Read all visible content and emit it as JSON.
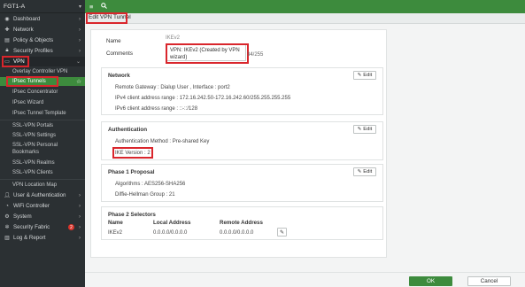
{
  "device": "FGT1-A",
  "topbar": {
    "menu_icon": "≡",
    "search_icon": "🔍"
  },
  "breadcrumb": "Edit VPN Tunnel",
  "sidebar": {
    "items": [
      {
        "label": "Dashboard",
        "icon": "dashboard-icon"
      },
      {
        "label": "Network",
        "icon": "network-icon"
      },
      {
        "label": "Policy & Objects",
        "icon": "policy-icon"
      },
      {
        "label": "Security Profiles",
        "icon": "lock-icon"
      },
      {
        "label": "VPN",
        "icon": "monitor-icon"
      },
      {
        "label": "User & Authentication",
        "icon": "user-icon"
      },
      {
        "label": "WiFi Controller",
        "icon": "wifi-icon"
      },
      {
        "label": "System",
        "icon": "gear-icon"
      },
      {
        "label": "Security Fabric",
        "icon": "fabric-icon",
        "badge": "2"
      },
      {
        "label": "Log & Report",
        "icon": "chart-icon"
      }
    ],
    "vpn_sub": [
      "Overlay Controller VPN",
      "IPsec Tunnels",
      "IPsec Concentrator",
      "IPsec Wizard",
      "IPsec Tunnel Template",
      "SSL-VPN Portals",
      "SSL-VPN Settings",
      "SSL-VPN Personal Bookmarks",
      "SSL-VPN Realms",
      "SSL-VPN Clients",
      "VPN Location Map"
    ]
  },
  "form": {
    "name_label": "Name",
    "name_value": "IKEv2",
    "comments_label": "Comments",
    "comments_value": "VPN: IKEv2 (Created by VPN wizard)",
    "comments_counter": "34/255"
  },
  "sections": {
    "network": {
      "title": "Network",
      "lines": [
        "Remote Gateway : Dialup User , Interface : port2",
        "IPv4 client address range : 172.16.242.50-172.16.242.60/255.255.255.255",
        "IPv6 client address range : ::-::/128"
      ]
    },
    "authentication": {
      "title": "Authentication",
      "lines": [
        "Authentication Method : Pre-shared Key",
        "IKE Version : 2"
      ]
    },
    "phase1": {
      "title": "Phase 1 Proposal",
      "lines": [
        "Algorithms : AES256-SHA256",
        "Diffie-Hellman Group : 21"
      ]
    },
    "phase2": {
      "title": "Phase 2 Selectors",
      "columns": [
        "Name",
        "Local Address",
        "Remote Address"
      ],
      "rows": [
        [
          "IKEv2",
          "0.0.0.0/0.0.0.0",
          "0.0.0.0/0.0.0.0"
        ]
      ]
    }
  },
  "edit_label": "Edit",
  "buttons": {
    "ok": "OK",
    "cancel": "Cancel"
  },
  "colors": {
    "accent": "#3d8b3d",
    "highlight": "#d9262c",
    "sidebar": "#2b3033"
  }
}
